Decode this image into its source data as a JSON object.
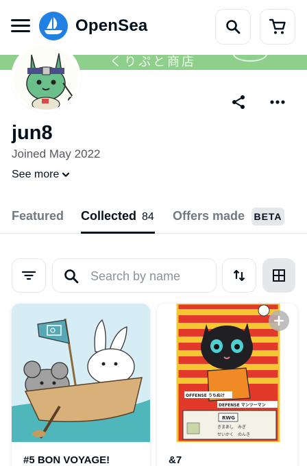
{
  "header": {
    "brand": "OpenSea",
    "icons": {
      "menu": "hamburger-menu-icon",
      "logo": "opensea-logo-icon",
      "search": "search-icon",
      "cart": "cart-icon"
    }
  },
  "banner": {
    "text": "くりぷと商店"
  },
  "profile": {
    "username": "jun8",
    "joined": "Joined May 2022",
    "see_more": "See more"
  },
  "tabs": [
    {
      "label": "Featured"
    },
    {
      "label": "Collected",
      "count": "84"
    },
    {
      "label": "Offers made",
      "badge": "BETA"
    }
  ],
  "filters": {
    "search_placeholder": "Search by name"
  },
  "cards": [
    {
      "title": "#5 BON VOYAGE!"
    },
    {
      "title": "&7",
      "art": {
        "offense": "OFFENSE うちぬけ",
        "defense": "DEFENSE マンツーマン",
        "chip": "RWG",
        "row1": "きまあし　みぎ",
        "row2": "せいかく　のんき"
      }
    }
  ],
  "colors": {
    "text": "#04111d",
    "muted": "#707a83",
    "border": "#e5e8eb",
    "brand_blue": "#2081e2",
    "banner_green": "#8fcf8c"
  }
}
